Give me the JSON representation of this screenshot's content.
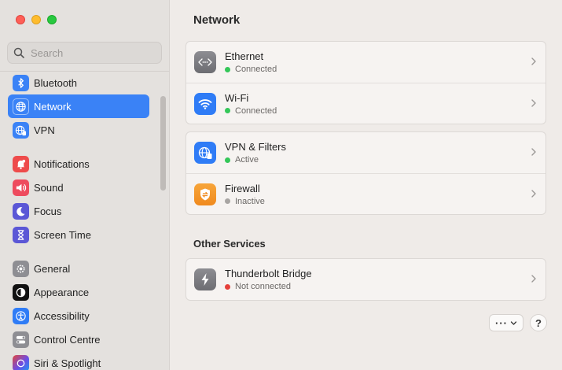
{
  "sidebar": {
    "search_placeholder": "Search",
    "items": [
      {
        "label": "Bluetooth",
        "icon": "bluetooth-icon",
        "color": "#3a82f6"
      },
      {
        "label": "Network",
        "icon": "globe-icon",
        "color": "#3a82f6",
        "selected": true
      },
      {
        "label": "VPN",
        "icon": "vpn-globe-icon",
        "color": "#3a82f6"
      },
      {
        "label": "Notifications",
        "icon": "bell-icon",
        "color": "#ee4b4b"
      },
      {
        "label": "Sound",
        "icon": "speaker-icon",
        "color": "#ee4b5e"
      },
      {
        "label": "Focus",
        "icon": "moon-icon",
        "color": "#5b57d6"
      },
      {
        "label": "Screen Time",
        "icon": "hourglass-icon",
        "color": "#5b57d6"
      },
      {
        "label": "General",
        "icon": "gear-icon",
        "color": "#8e8e93"
      },
      {
        "label": "Appearance",
        "icon": "appearance-icon",
        "color": "#111111"
      },
      {
        "label": "Accessibility",
        "icon": "accessibility-icon",
        "color": "#2f7cf6"
      },
      {
        "label": "Control Centre",
        "icon": "toggles-icon",
        "color": "#8e8e93"
      },
      {
        "label": "Siri & Spotlight",
        "icon": "siri-icon",
        "color": "#6b4de6"
      }
    ]
  },
  "main": {
    "title": "Network",
    "groups": [
      {
        "rows": [
          {
            "title": "Ethernet",
            "status": "Connected",
            "status_color": "#34c759",
            "icon": "ethernet-icon"
          },
          {
            "title": "Wi-Fi",
            "status": "Connected",
            "status_color": "#34c759",
            "icon": "wifi-icon"
          }
        ]
      },
      {
        "rows": [
          {
            "title": "VPN & Filters",
            "status": "Active",
            "status_color": "#34c759",
            "icon": "vpn-globe-icon"
          },
          {
            "title": "Firewall",
            "status": "Inactive",
            "status_color": "#a8a5a3",
            "icon": "firewall-icon"
          }
        ]
      }
    ],
    "other_services_title": "Other Services",
    "other_services": [
      {
        "title": "Thunderbolt Bridge",
        "status": "Not connected",
        "status_color": "#e5403a",
        "icon": "thunderbolt-icon"
      }
    ],
    "more_button_label": "···",
    "help_button_label": "?"
  },
  "colors": {
    "accent": "#3a82f6",
    "connected": "#34c759",
    "inactive": "#a8a5a3",
    "disconnected": "#e5403a"
  }
}
